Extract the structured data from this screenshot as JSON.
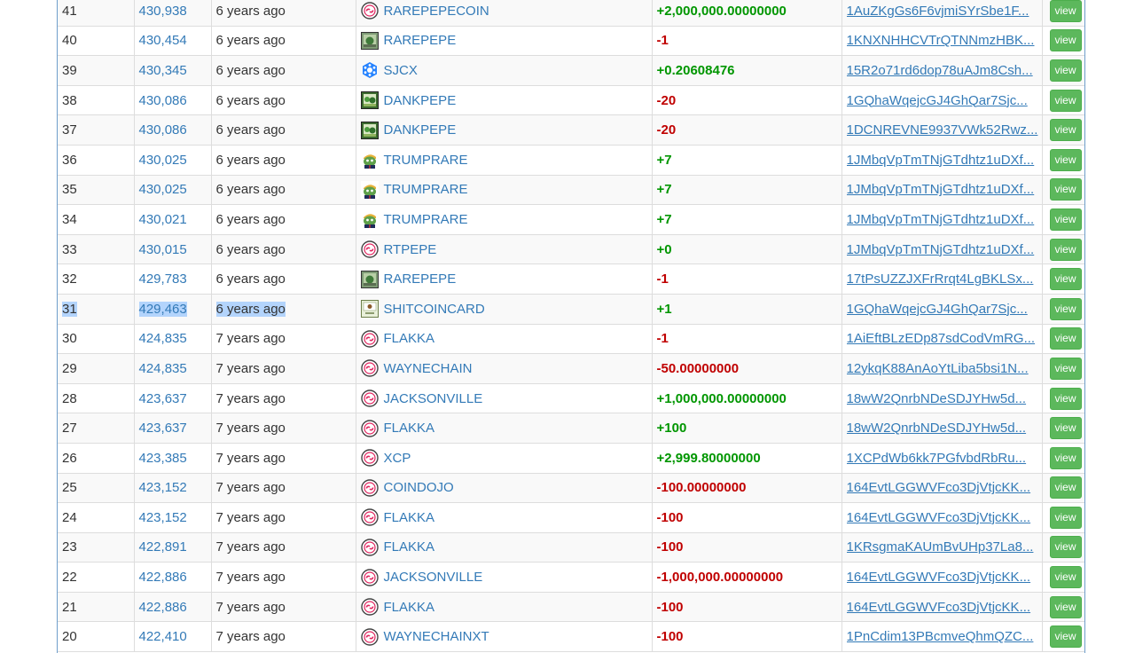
{
  "table": {
    "button_label": "view",
    "rows": [
      {
        "index": "41",
        "block": "430,938",
        "time": "6 years ago",
        "asset": "RAREPEPECOIN",
        "icon": "counterparty-icon",
        "quantity": "+2,000,000.00000000",
        "sign": "pos",
        "address": "1AuZKgGs6F6vjmiSYrSbe1F..."
      },
      {
        "index": "40",
        "block": "430,454",
        "time": "6 years ago",
        "asset": "RAREPEPE",
        "icon": "rarepepe-card-icon",
        "quantity": "-1",
        "sign": "neg",
        "address": "1KNXNHHCVTrQTNNmzHBK..."
      },
      {
        "index": "39",
        "block": "430,345",
        "time": "6 years ago",
        "asset": "SJCX",
        "icon": "storj-icon",
        "quantity": "+0.20608476",
        "sign": "pos",
        "address": "15R2o71rd6dop78uAJm8Csh..."
      },
      {
        "index": "38",
        "block": "430,086",
        "time": "6 years ago",
        "asset": "DANKPEPE",
        "icon": "dankpepe-card-icon",
        "quantity": "-20",
        "sign": "neg",
        "address": "1GQhaWqejcGJ4GhQar7Sjc..."
      },
      {
        "index": "37",
        "block": "430,086",
        "time": "6 years ago",
        "asset": "DANKPEPE",
        "icon": "dankpepe-card-icon",
        "quantity": "-20",
        "sign": "neg",
        "address": "1DCNREVNE9937VWk52Rwz..."
      },
      {
        "index": "36",
        "block": "430,025",
        "time": "6 years ago",
        "asset": "TRUMPRARE",
        "icon": "trumppepe-icon",
        "quantity": "+7",
        "sign": "pos",
        "address": "1JMbqVpTmTNjGTdhtz1uDXf..."
      },
      {
        "index": "35",
        "block": "430,025",
        "time": "6 years ago",
        "asset": "TRUMPRARE",
        "icon": "trumppepe-icon",
        "quantity": "+7",
        "sign": "pos",
        "address": "1JMbqVpTmTNjGTdhtz1uDXf..."
      },
      {
        "index": "34",
        "block": "430,021",
        "time": "6 years ago",
        "asset": "TRUMPRARE",
        "icon": "trumppepe-icon",
        "quantity": "+7",
        "sign": "pos",
        "address": "1JMbqVpTmTNjGTdhtz1uDXf..."
      },
      {
        "index": "33",
        "block": "430,015",
        "time": "6 years ago",
        "asset": "RTPEPE",
        "icon": "counterparty-icon",
        "quantity": "+0",
        "sign": "pos",
        "address": "1JMbqVpTmTNjGTdhtz1uDXf..."
      },
      {
        "index": "32",
        "block": "429,783",
        "time": "6 years ago",
        "asset": "RAREPEPE",
        "icon": "rarepepe-card-icon",
        "quantity": "-1",
        "sign": "neg",
        "address": "17tPsUZZJXFrRrqt4LgBKLSx..."
      },
      {
        "index": "31",
        "block": "429,463",
        "time": "6 years ago",
        "asset": "SHITCOINCARD",
        "icon": "shitcoin-card-icon",
        "quantity": "+1",
        "sign": "pos",
        "address": "1GQhaWqejcGJ4GhQar7Sjc...",
        "selected": true
      },
      {
        "index": "30",
        "block": "424,835",
        "time": "7 years ago",
        "asset": "FLAKKA",
        "icon": "counterparty-icon",
        "quantity": "-1",
        "sign": "neg",
        "address": "1AiEftBLzEDp87sdCodVmRG..."
      },
      {
        "index": "29",
        "block": "424,835",
        "time": "7 years ago",
        "asset": "WAYNECHAIN",
        "icon": "counterparty-icon",
        "quantity": "-50.00000000",
        "sign": "neg",
        "address": "12ykqK88AnAoYtLiba5bsi1N..."
      },
      {
        "index": "28",
        "block": "423,637",
        "time": "7 years ago",
        "asset": "JACKSONVILLE",
        "icon": "counterparty-icon",
        "quantity": "+1,000,000.00000000",
        "sign": "pos",
        "address": "18wW2QnrbNDeSDJYHw5d..."
      },
      {
        "index": "27",
        "block": "423,637",
        "time": "7 years ago",
        "asset": "FLAKKA",
        "icon": "counterparty-icon",
        "quantity": "+100",
        "sign": "pos",
        "address": "18wW2QnrbNDeSDJYHw5d..."
      },
      {
        "index": "26",
        "block": "423,385",
        "time": "7 years ago",
        "asset": "XCP",
        "icon": "counterparty-icon",
        "quantity": "+2,999.80000000",
        "sign": "pos",
        "address": "1XCPdWb6kk7PGfvbdRbRu..."
      },
      {
        "index": "25",
        "block": "423,152",
        "time": "7 years ago",
        "asset": "COINDOJO",
        "icon": "counterparty-icon",
        "quantity": "-100.00000000",
        "sign": "neg",
        "address": "164EvtLGGWVFco3DjVtjcKK..."
      },
      {
        "index": "24",
        "block": "423,152",
        "time": "7 years ago",
        "asset": "FLAKKA",
        "icon": "counterparty-icon",
        "quantity": "-100",
        "sign": "neg",
        "address": "164EvtLGGWVFco3DjVtjcKK..."
      },
      {
        "index": "23",
        "block": "422,891",
        "time": "7 years ago",
        "asset": "FLAKKA",
        "icon": "counterparty-icon",
        "quantity": "-100",
        "sign": "neg",
        "address": "1KRsgmaKAUmBvUHp37La8..."
      },
      {
        "index": "22",
        "block": "422,886",
        "time": "7 years ago",
        "asset": "JACKSONVILLE",
        "icon": "counterparty-icon",
        "quantity": "-1,000,000.00000000",
        "sign": "neg",
        "address": "164EvtLGGWVFco3DjVtjcKK..."
      },
      {
        "index": "21",
        "block": "422,886",
        "time": "7 years ago",
        "asset": "FLAKKA",
        "icon": "counterparty-icon",
        "quantity": "-100",
        "sign": "neg",
        "address": "164EvtLGGWVFco3DjVtjcKK..."
      },
      {
        "index": "20",
        "block": "422,410",
        "time": "7 years ago",
        "asset": "WAYNECHAINXT",
        "icon": "counterparty-icon",
        "quantity": "-100",
        "sign": "neg",
        "address": "1PnCdim13PBcmveQhmQZC..."
      }
    ]
  },
  "colors": {
    "link": "#337ab7",
    "positive": "#009600",
    "negative": "#c00000",
    "button": "#5cb85c",
    "selection": "#b3d4fc"
  }
}
